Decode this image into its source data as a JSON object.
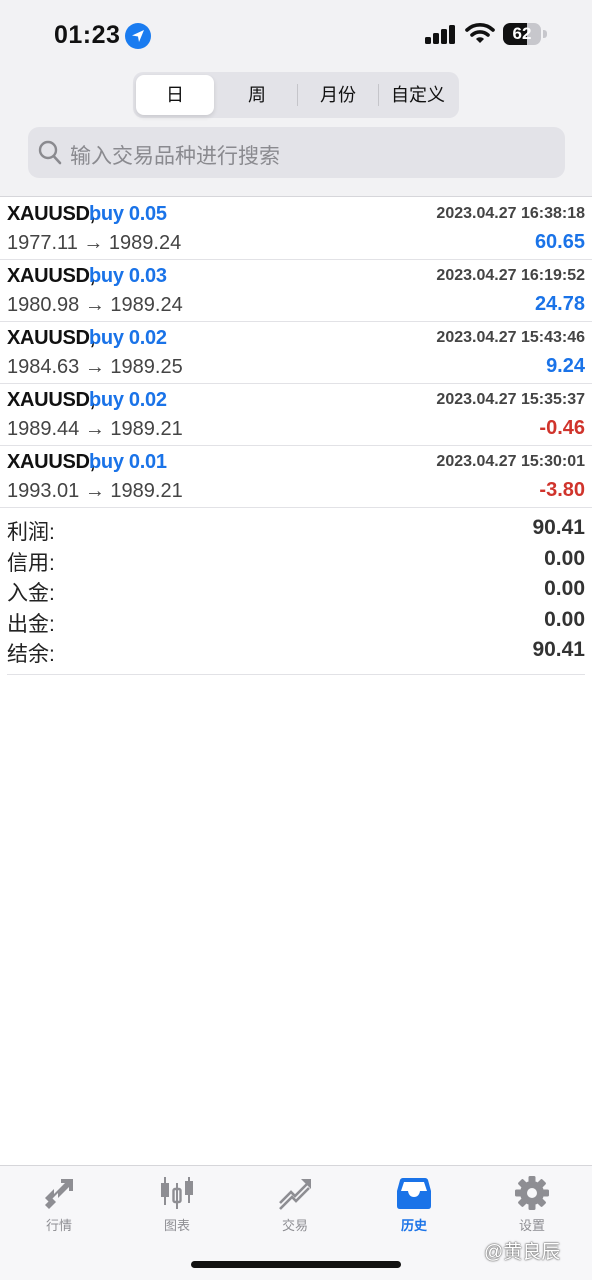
{
  "status_bar": {
    "time": "01:23",
    "battery": "62"
  },
  "period_tabs": [
    {
      "label": "日",
      "active": true
    },
    {
      "label": "周",
      "active": false
    },
    {
      "label": "月份",
      "active": false
    },
    {
      "label": "自定义",
      "active": false
    }
  ],
  "search": {
    "placeholder": "输入交易品种进行搜索"
  },
  "trades": [
    {
      "symbol": "XAUUSD,",
      "side": "buy 0.05",
      "time": "2023.04.27 16:38:18",
      "prices": "1977.11 → 1989.24",
      "profit": "60.65",
      "profit_color": "#1a73e8"
    },
    {
      "symbol": "XAUUSD,",
      "side": "buy 0.03",
      "time": "2023.04.27 16:19:52",
      "prices": "1980.98 → 1989.24",
      "profit": "24.78",
      "profit_color": "#1a73e8"
    },
    {
      "symbol": "XAUUSD,",
      "side": "buy 0.02",
      "time": "2023.04.27 15:43:46",
      "prices": "1984.63 → 1989.25",
      "profit": "9.24",
      "profit_color": "#1a73e8"
    },
    {
      "symbol": "XAUUSD,",
      "side": "buy 0.02",
      "time": "2023.04.27 15:35:37",
      "prices": "1989.44 → 1989.21",
      "profit": "-0.46",
      "profit_color": "#d0342c"
    },
    {
      "symbol": "XAUUSD,",
      "side": "buy 0.01",
      "time": "2023.04.27 15:30:01",
      "prices": "1993.01 → 1989.21",
      "profit": "-3.80",
      "profit_color": "#d0342c"
    }
  ],
  "summary": [
    {
      "label": "利润:",
      "value": "90.41"
    },
    {
      "label": "信用:",
      "value": "0.00"
    },
    {
      "label": "入金:",
      "value": "0.00"
    },
    {
      "label": "出金:",
      "value": "0.00"
    },
    {
      "label": "结余:",
      "value": "90.41"
    }
  ],
  "tab_bar": [
    {
      "label": "行情",
      "icon": "quotes-icon",
      "active": false
    },
    {
      "label": "图表",
      "icon": "chart-icon",
      "active": false
    },
    {
      "label": "交易",
      "icon": "trade-icon",
      "active": false
    },
    {
      "label": "历史",
      "icon": "history-icon",
      "active": true
    },
    {
      "label": "设置",
      "icon": "settings-icon",
      "active": false
    }
  ],
  "watermark": "@黄良辰",
  "colors": {
    "accent": "#1a73e8",
    "loss": "#d0342c",
    "header_bg": "#f2f2f4"
  }
}
